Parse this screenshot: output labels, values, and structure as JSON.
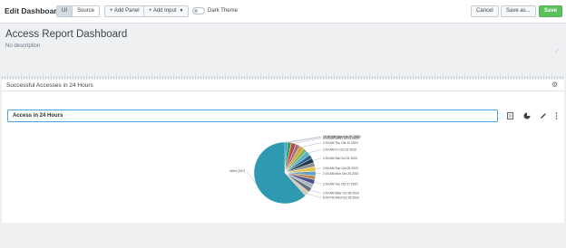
{
  "header": {
    "title": "Edit Dashboard",
    "mode_ui": "UI",
    "mode_source": "Source",
    "add_panel": "+ Add Panel",
    "add_input": "+ Add Input",
    "dark_theme": "Dark Theme",
    "cancel": "Cancel",
    "save_as": "Save as...",
    "save": "Save"
  },
  "dashboard": {
    "title": "Access Report Dashboard",
    "description": "No description"
  },
  "panel": {
    "title": "Successful Accesses in 24 Hours",
    "search_title": "Access in 24 Hours"
  },
  "colors": {
    "accent_blue": "#4aa3df",
    "save_green": "#5cc05c"
  },
  "icons": {
    "settings": "gear-icon",
    "inspect": "document-icon",
    "visualization": "pie-icon",
    "edit": "pencil-icon",
    "more": "kebab-icon"
  },
  "chart_data": {
    "type": "pie",
    "slices": [
      {
        "label": "10:00 PM Tue Oct 20 2020",
        "value": 2.5,
        "color": "#1e93c6"
      },
      {
        "label": "12:00 AM Wed Oct 21 2020",
        "value": 4,
        "color": "#3c9a63"
      },
      {
        "label": "2:00 AM Wed Oct 21 2020",
        "value": 4.5,
        "color": "#c0463a"
      },
      {
        "label": "",
        "value": 4,
        "color": "#956e96"
      },
      {
        "label": "2:00 AM Thu Oct 22 2020",
        "value": 4.5,
        "color": "#d9a23a"
      },
      {
        "label": "",
        "value": 4,
        "color": "#7fb65a"
      },
      {
        "label": "2:00 AM Fri Oct 23 2020",
        "value": 4.5,
        "color": "#5cb0c4"
      },
      {
        "label": "",
        "value": 4,
        "color": "#2f5f8a"
      },
      {
        "label": "2:00 AM Sat Oct 24 2020",
        "value": 4.5,
        "color": "#1f3b4d"
      },
      {
        "label": "",
        "value": 4,
        "color": "#8c8c8c"
      },
      {
        "label": "2:00 AM Sun Oct 25 2020",
        "value": 4.5,
        "color": "#e3c84a"
      },
      {
        "label": "2:00 AM Mon Oct 26 2020",
        "value": 4.5,
        "color": "#6a9ec7"
      },
      {
        "label": "",
        "value": 4,
        "color": "#b88a5a"
      },
      {
        "label": "2:00 AM Tue Oct 27 2020",
        "value": 4.5,
        "color": "#4b4b8f"
      },
      {
        "label": "",
        "value": 4,
        "color": "#a9b6bf"
      },
      {
        "label": "2:00 AM Wed Oct 28 2020",
        "value": 4.5,
        "color": "#63717d"
      },
      {
        "label": "8:00 PM Wed Oct 28 2020",
        "value": 5,
        "color": "#d3cbb8"
      },
      {
        "label": "other (347)",
        "value": 115,
        "color": "#2d9ab1"
      }
    ]
  }
}
